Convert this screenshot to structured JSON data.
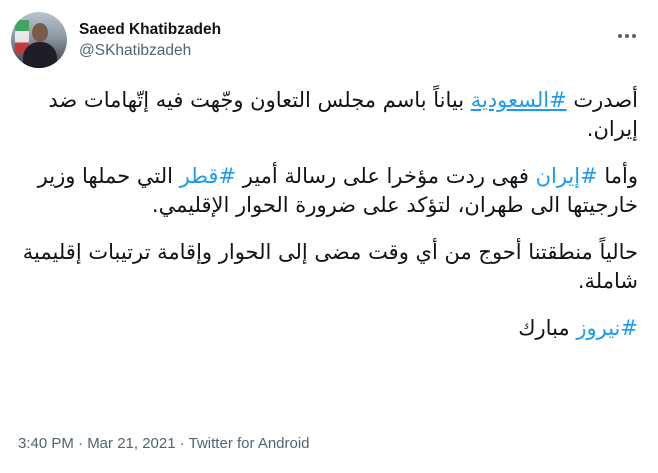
{
  "author": {
    "display_name": "Saeed Khatibzadeh",
    "handle": "@SKhatibzadeh"
  },
  "tweet": {
    "p1": {
      "before": "أصدرت ",
      "hashtag": "#السعودية",
      "after": " بياناً باسم مجلس التعاون وجّهت فيه إتّهامات ضد إيران."
    },
    "p2": {
      "before": "وأما ",
      "hashtag1": "#إيران",
      "middle": " فهى ردت مؤخرا على رسالة أمير ",
      "hashtag2": "#قطر",
      "after": " التي حملها وزير خارجيتها الى طهران، لتؤكد على ضرورة الحوار الإقليمي."
    },
    "p3": "حالياً منطقتنا أحوج من أي وقت مضى إلى الحوار وإقامة ترتيبات إقليمية شاملة.",
    "p4": {
      "hashtag": "#نيروز",
      "after": " مبارك"
    }
  },
  "meta": {
    "timestamp": "3:40 PM · Mar 21, 2021 · Twitter for Android"
  },
  "colors": {
    "hashtag": "#1d9bf0",
    "secondary_text": "#536471"
  }
}
